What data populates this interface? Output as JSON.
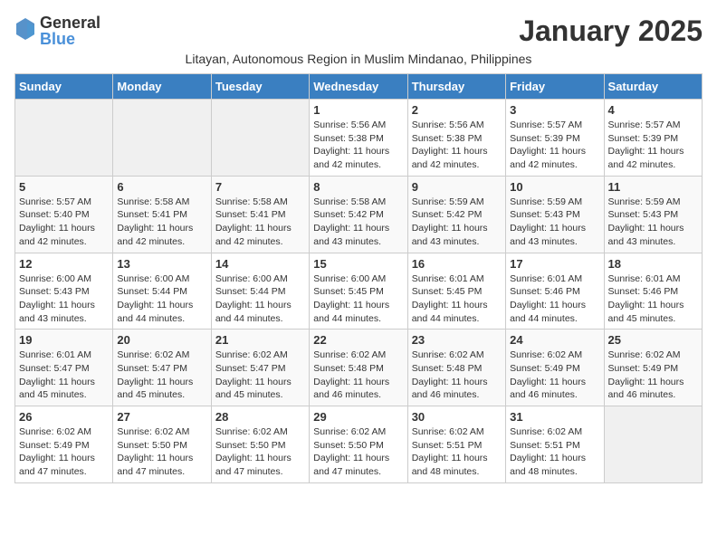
{
  "logo": {
    "general": "General",
    "blue": "Blue"
  },
  "title": "January 2025",
  "subtitle": "Litayan, Autonomous Region in Muslim Mindanao, Philippines",
  "days_of_week": [
    "Sunday",
    "Monday",
    "Tuesday",
    "Wednesday",
    "Thursday",
    "Friday",
    "Saturday"
  ],
  "weeks": [
    [
      {
        "day": "",
        "sunrise": "",
        "sunset": "",
        "daylight": ""
      },
      {
        "day": "",
        "sunrise": "",
        "sunset": "",
        "daylight": ""
      },
      {
        "day": "",
        "sunrise": "",
        "sunset": "",
        "daylight": ""
      },
      {
        "day": "1",
        "sunrise": "Sunrise: 5:56 AM",
        "sunset": "Sunset: 5:38 PM",
        "daylight": "Daylight: 11 hours and 42 minutes."
      },
      {
        "day": "2",
        "sunrise": "Sunrise: 5:56 AM",
        "sunset": "Sunset: 5:38 PM",
        "daylight": "Daylight: 11 hours and 42 minutes."
      },
      {
        "day": "3",
        "sunrise": "Sunrise: 5:57 AM",
        "sunset": "Sunset: 5:39 PM",
        "daylight": "Daylight: 11 hours and 42 minutes."
      },
      {
        "day": "4",
        "sunrise": "Sunrise: 5:57 AM",
        "sunset": "Sunset: 5:39 PM",
        "daylight": "Daylight: 11 hours and 42 minutes."
      }
    ],
    [
      {
        "day": "5",
        "sunrise": "Sunrise: 5:57 AM",
        "sunset": "Sunset: 5:40 PM",
        "daylight": "Daylight: 11 hours and 42 minutes."
      },
      {
        "day": "6",
        "sunrise": "Sunrise: 5:58 AM",
        "sunset": "Sunset: 5:41 PM",
        "daylight": "Daylight: 11 hours and 42 minutes."
      },
      {
        "day": "7",
        "sunrise": "Sunrise: 5:58 AM",
        "sunset": "Sunset: 5:41 PM",
        "daylight": "Daylight: 11 hours and 42 minutes."
      },
      {
        "day": "8",
        "sunrise": "Sunrise: 5:58 AM",
        "sunset": "Sunset: 5:42 PM",
        "daylight": "Daylight: 11 hours and 43 minutes."
      },
      {
        "day": "9",
        "sunrise": "Sunrise: 5:59 AM",
        "sunset": "Sunset: 5:42 PM",
        "daylight": "Daylight: 11 hours and 43 minutes."
      },
      {
        "day": "10",
        "sunrise": "Sunrise: 5:59 AM",
        "sunset": "Sunset: 5:43 PM",
        "daylight": "Daylight: 11 hours and 43 minutes."
      },
      {
        "day": "11",
        "sunrise": "Sunrise: 5:59 AM",
        "sunset": "Sunset: 5:43 PM",
        "daylight": "Daylight: 11 hours and 43 minutes."
      }
    ],
    [
      {
        "day": "12",
        "sunrise": "Sunrise: 6:00 AM",
        "sunset": "Sunset: 5:43 PM",
        "daylight": "Daylight: 11 hours and 43 minutes."
      },
      {
        "day": "13",
        "sunrise": "Sunrise: 6:00 AM",
        "sunset": "Sunset: 5:44 PM",
        "daylight": "Daylight: 11 hours and 44 minutes."
      },
      {
        "day": "14",
        "sunrise": "Sunrise: 6:00 AM",
        "sunset": "Sunset: 5:44 PM",
        "daylight": "Daylight: 11 hours and 44 minutes."
      },
      {
        "day": "15",
        "sunrise": "Sunrise: 6:00 AM",
        "sunset": "Sunset: 5:45 PM",
        "daylight": "Daylight: 11 hours and 44 minutes."
      },
      {
        "day": "16",
        "sunrise": "Sunrise: 6:01 AM",
        "sunset": "Sunset: 5:45 PM",
        "daylight": "Daylight: 11 hours and 44 minutes."
      },
      {
        "day": "17",
        "sunrise": "Sunrise: 6:01 AM",
        "sunset": "Sunset: 5:46 PM",
        "daylight": "Daylight: 11 hours and 44 minutes."
      },
      {
        "day": "18",
        "sunrise": "Sunrise: 6:01 AM",
        "sunset": "Sunset: 5:46 PM",
        "daylight": "Daylight: 11 hours and 45 minutes."
      }
    ],
    [
      {
        "day": "19",
        "sunrise": "Sunrise: 6:01 AM",
        "sunset": "Sunset: 5:47 PM",
        "daylight": "Daylight: 11 hours and 45 minutes."
      },
      {
        "day": "20",
        "sunrise": "Sunrise: 6:02 AM",
        "sunset": "Sunset: 5:47 PM",
        "daylight": "Daylight: 11 hours and 45 minutes."
      },
      {
        "day": "21",
        "sunrise": "Sunrise: 6:02 AM",
        "sunset": "Sunset: 5:47 PM",
        "daylight": "Daylight: 11 hours and 45 minutes."
      },
      {
        "day": "22",
        "sunrise": "Sunrise: 6:02 AM",
        "sunset": "Sunset: 5:48 PM",
        "daylight": "Daylight: 11 hours and 46 minutes."
      },
      {
        "day": "23",
        "sunrise": "Sunrise: 6:02 AM",
        "sunset": "Sunset: 5:48 PM",
        "daylight": "Daylight: 11 hours and 46 minutes."
      },
      {
        "day": "24",
        "sunrise": "Sunrise: 6:02 AM",
        "sunset": "Sunset: 5:49 PM",
        "daylight": "Daylight: 11 hours and 46 minutes."
      },
      {
        "day": "25",
        "sunrise": "Sunrise: 6:02 AM",
        "sunset": "Sunset: 5:49 PM",
        "daylight": "Daylight: 11 hours and 46 minutes."
      }
    ],
    [
      {
        "day": "26",
        "sunrise": "Sunrise: 6:02 AM",
        "sunset": "Sunset: 5:49 PM",
        "daylight": "Daylight: 11 hours and 47 minutes."
      },
      {
        "day": "27",
        "sunrise": "Sunrise: 6:02 AM",
        "sunset": "Sunset: 5:50 PM",
        "daylight": "Daylight: 11 hours and 47 minutes."
      },
      {
        "day": "28",
        "sunrise": "Sunrise: 6:02 AM",
        "sunset": "Sunset: 5:50 PM",
        "daylight": "Daylight: 11 hours and 47 minutes."
      },
      {
        "day": "29",
        "sunrise": "Sunrise: 6:02 AM",
        "sunset": "Sunset: 5:50 PM",
        "daylight": "Daylight: 11 hours and 47 minutes."
      },
      {
        "day": "30",
        "sunrise": "Sunrise: 6:02 AM",
        "sunset": "Sunset: 5:51 PM",
        "daylight": "Daylight: 11 hours and 48 minutes."
      },
      {
        "day": "31",
        "sunrise": "Sunrise: 6:02 AM",
        "sunset": "Sunset: 5:51 PM",
        "daylight": "Daylight: 11 hours and 48 minutes."
      },
      {
        "day": "",
        "sunrise": "",
        "sunset": "",
        "daylight": ""
      }
    ]
  ]
}
